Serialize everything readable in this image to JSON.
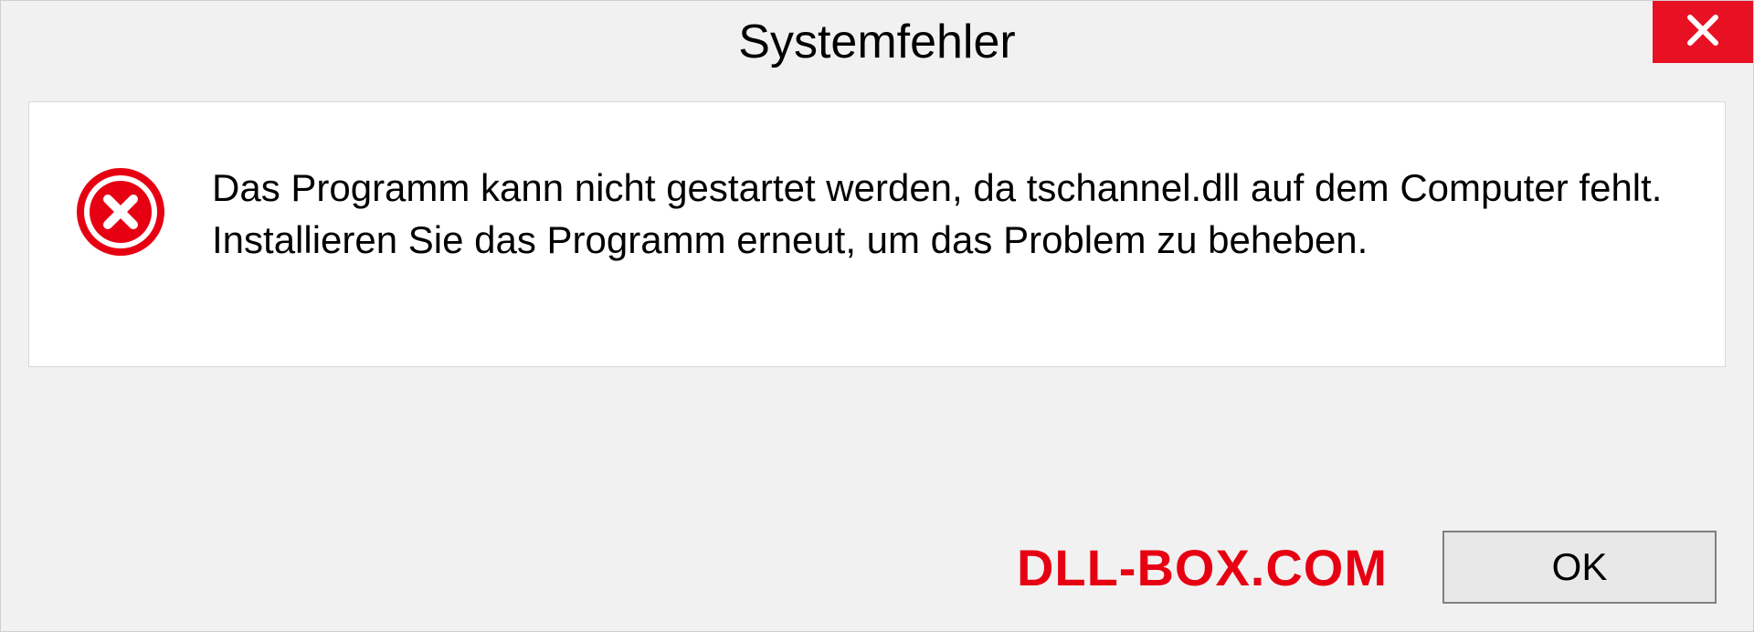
{
  "dialog": {
    "title": "Systemfehler",
    "message": "Das Programm kann nicht gestartet werden, da tschannel.dll auf dem Computer fehlt. Installieren Sie das Programm erneut, um das Problem zu beheben.",
    "ok_label": "OK"
  },
  "watermark": "DLL-BOX.COM"
}
